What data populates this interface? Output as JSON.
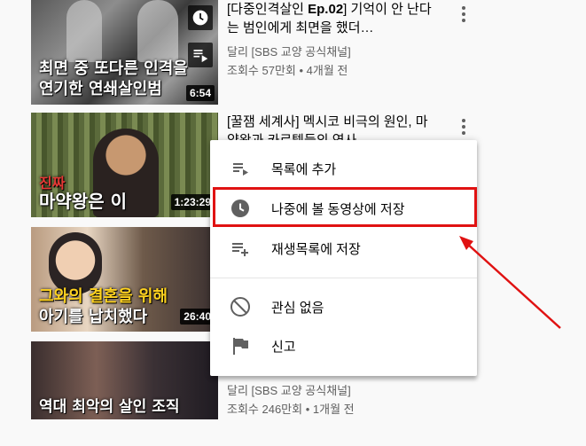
{
  "videos": [
    {
      "title_prefix": "[다중인격살인 ",
      "title_bold": "Ep.02",
      "title_rest": "] 기억이 안 난다는 범인에게 최면을 했더…",
      "channel": "달리 [SBS 교양 공식채널]",
      "meta": "조회수 57만회 • 4개월 전",
      "duration": "6:54",
      "caption_line1": "최면 중 또다른 인격을",
      "caption_line2a": "연기한 ",
      "caption_line2b": "연쇄살인범"
    },
    {
      "title_prefix": "",
      "title_bold": "",
      "title_rest": "[꿀잼 세계사] 멕시코 비극의 원인, 마약왕과 카르텔들의 역사",
      "channel": "",
      "meta": "",
      "duration": "1:23:29",
      "caption_line1": "진짜",
      "caption_line2a": "마약왕",
      "caption_line2b": "은 이"
    },
    {
      "title_prefix": "",
      "title_bold": "",
      "title_rest": "",
      "channel": "",
      "meta": "",
      "duration": "26:40",
      "caption_line1": "그와의 결혼을 위해",
      "caption_line2a": "아기를 납치했다",
      "caption_line2b": ""
    },
    {
      "title_prefix": "",
      "title_bold": "",
      "title_rest": "",
      "channel": "달리 [SBS 교양 공식채널]",
      "meta": "조회수 246만회 • 1개월 전",
      "duration": "",
      "caption_line1": "역대 최악의 살인 조직",
      "caption_line2a": "",
      "caption_line2b": ""
    }
  ],
  "menu": {
    "items": [
      {
        "label": "목록에 추가",
        "icon": "queue-icon"
      },
      {
        "label": "나중에 볼 동영상에 저장",
        "icon": "clock-icon"
      },
      {
        "label": "재생목록에 저장",
        "icon": "playlist-add-icon"
      },
      {
        "label": "관심 없음",
        "icon": "block-icon"
      },
      {
        "label": "신고",
        "icon": "flag-icon"
      }
    ]
  },
  "colors": {
    "annotation_red": "#e01212",
    "caption_yellow": "#ffd21f"
  }
}
